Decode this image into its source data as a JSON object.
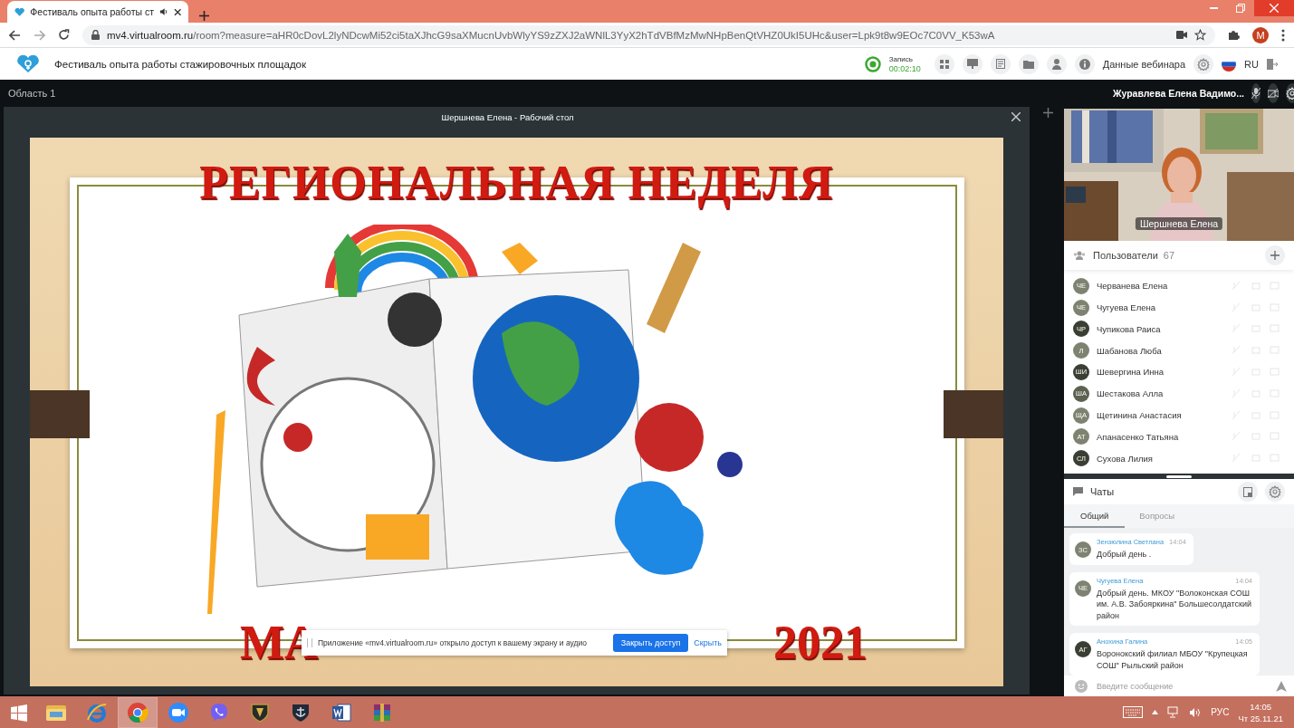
{
  "browser": {
    "tab": {
      "title": "Фестиваль опыта работы ст"
    },
    "address": {
      "domain": "mv4.virtualroom.ru",
      "path": "/room?measure=aHR0cDovL2lyNDcwMi52ci5taXJhcG9saXMucnUvbWlyYS9zZXJ2aWNlL3YyX2hTdVBfMzMwNHpBenQtVHZ0UkI5UHc&user=Lpk9t8w9EOc7C0VV_K53wA"
    },
    "profile": "M"
  },
  "app": {
    "title": "Фестиваль опыта работы стажировочных площадок",
    "record": {
      "label": "Запись",
      "time": "00:02:10"
    },
    "webinar_info": "Данные вебинара",
    "language": "RU"
  },
  "area": {
    "title": "Область 1",
    "window_title": "Шершнева Елена - Рабочий стол"
  },
  "slide": {
    "title_top": "РЕГИОНАЛЬНАЯ НЕДЕЛЯ",
    "title_bottom_parts": [
      "МА",
      "2021"
    ]
  },
  "share_bar": {
    "text": "Приложение «mv4.virtualroom.ru» открыло доступ к вашему экрану и аудио",
    "stop": "Закрыть доступ",
    "hide": "Скрыть"
  },
  "presenter": {
    "name": "Журавлева Елена Вадимо...",
    "video_label": "Шершнева Елена"
  },
  "users": {
    "title": "Пользователи",
    "count": "67",
    "items": [
      {
        "initials": "ЧЕ",
        "name": "Черванева Елена",
        "color": "#7d8370"
      },
      {
        "initials": "ЧЕ",
        "name": "Чугуева Елена",
        "color": "#7d8370"
      },
      {
        "initials": "ЧР",
        "name": "Чупикова Раиса",
        "color": "#3b3f33"
      },
      {
        "initials": "Л",
        "name": "Шабанова Люба",
        "color": "#7d8370"
      },
      {
        "initials": "ШИ",
        "name": "Шевергина Инна",
        "color": "#3b3f33"
      },
      {
        "initials": "ША",
        "name": "Шестакова Алла",
        "color": "#5c624f"
      },
      {
        "initials": "ЩА",
        "name": "Щетинина Анастасия",
        "color": "#7d8370"
      },
      {
        "initials": "АТ",
        "name": "Апанасенко Татьяна",
        "color": "#7d8370"
      },
      {
        "initials": "СЛ",
        "name": "Сухова Лилия",
        "color": "#3b3f33"
      }
    ]
  },
  "chat": {
    "title": "Чаты",
    "tabs": [
      {
        "label": "Общий",
        "selected": true
      },
      {
        "label": "Вопросы",
        "selected": false
      }
    ],
    "messages": [
      {
        "initials": "ЗС",
        "author": "Зензюлина Светлана",
        "time": "14:04",
        "text": "Добрый день .",
        "color": "#7d8370"
      },
      {
        "initials": "ЧЕ",
        "author": "Чугуева Елена",
        "time": "14:04",
        "text": "Добрый день. МКОУ \"Волоконская СОШ им. А.В. Забояркина\" Большесолдатский район",
        "color": "#7d8370"
      },
      {
        "initials": "АГ",
        "author": "Анохина Галина",
        "time": "14:05",
        "text": "Воронокский филиал МБОУ \"Крупецкая СОШ\" Рыльский район",
        "color": "#3b3f33"
      }
    ],
    "input": {
      "placeholder": "Введите сообщение"
    }
  },
  "taskbar": {
    "apps": [
      {
        "kind": "folder",
        "selected": false
      },
      {
        "kind": "ie",
        "selected": false
      },
      {
        "kind": "chrome",
        "selected": true
      },
      {
        "kind": "zoom",
        "selected": false
      },
      {
        "kind": "viber",
        "selected": false
      },
      {
        "kind": "shield",
        "selected": false
      },
      {
        "kind": "warships",
        "selected": false
      },
      {
        "kind": "word",
        "selected": false
      },
      {
        "kind": "archive",
        "selected": false
      }
    ],
    "language": "РУС",
    "time": "14:05",
    "date": "Чт 25.11.21"
  }
}
